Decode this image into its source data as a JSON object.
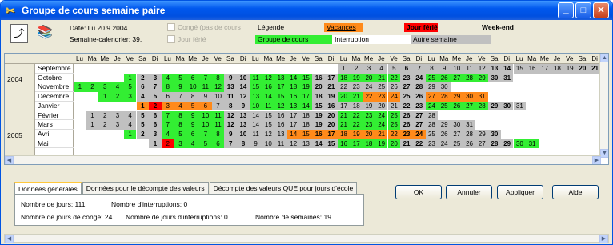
{
  "window": {
    "title": "Groupe de cours semaine paire",
    "min": "_",
    "max": "□",
    "close": "✕"
  },
  "toolbar": {
    "date": "Date: Lu 20.9.2004",
    "week": "Semaine-calendrier: 39,",
    "chk_conge": "Congé (pas de cours",
    "chk_ferie": "Jour férié",
    "legende": "Légende",
    "vacances": "Vacances",
    "jour_ferie": "Jour férié",
    "weekend": "Week-end",
    "groupe": "Groupe de cours",
    "interruption": "Interruption",
    "autre": "Autre semaine"
  },
  "colors": {
    "green": "#33ee33",
    "gray": "#c0c0c0",
    "orange": "#ff8a1a",
    "red": "#ff0000"
  },
  "grid": {
    "dow": [
      "Lu",
      "Ma",
      "Me",
      "Je",
      "Ve",
      "Sa",
      "Di",
      "Lu",
      "Ma",
      "Me",
      "Je",
      "Ve",
      "Sa",
      "Di",
      "Lu",
      "Ma",
      "Me",
      "Je",
      "Ve",
      "Sa",
      "Di",
      "Lu",
      "Ma",
      "Me",
      "Je",
      "Ve",
      "Sa",
      "Di",
      "Lu",
      "Ma",
      "Me",
      "Je",
      "Ve",
      "Sa",
      "Di",
      "Lu",
      "Ma",
      "Me",
      "Je",
      "Ve",
      "Sa",
      "Di",
      "Lu",
      "Ma",
      "Me"
    ],
    "years": [
      {
        "label": "2004",
        "row": 1
      },
      {
        "label": "2005",
        "row": 7
      }
    ],
    "months": [
      "Septembre",
      "Octobre",
      "Novembre",
      "Décembre",
      "Janvier",
      "Février",
      "Mars",
      "Avril",
      "Mai"
    ],
    "rows": [
      {
        "start": 21,
        "days": 30,
        "colors": {
          "20": "g",
          "21": "g",
          "22": "g",
          "23": "g",
          "24": "g",
          "25": "g",
          "26": "g"
        }
      },
      {
        "start": 4,
        "days": 31,
        "def": "gg"
      },
      {
        "start": 0,
        "days": 30,
        "def": "gn"
      },
      {
        "start": 2,
        "days": 31,
        "def": "gd"
      },
      {
        "start": 5,
        "days": 31,
        "def": "jan"
      },
      {
        "start": 1,
        "days": 28,
        "def": "gg"
      },
      {
        "start": 1,
        "days": 31,
        "def": "gm"
      },
      {
        "start": 4,
        "days": 30,
        "def": "av"
      },
      {
        "start": 6,
        "days": 31,
        "def": "mai"
      }
    ]
  }
}
